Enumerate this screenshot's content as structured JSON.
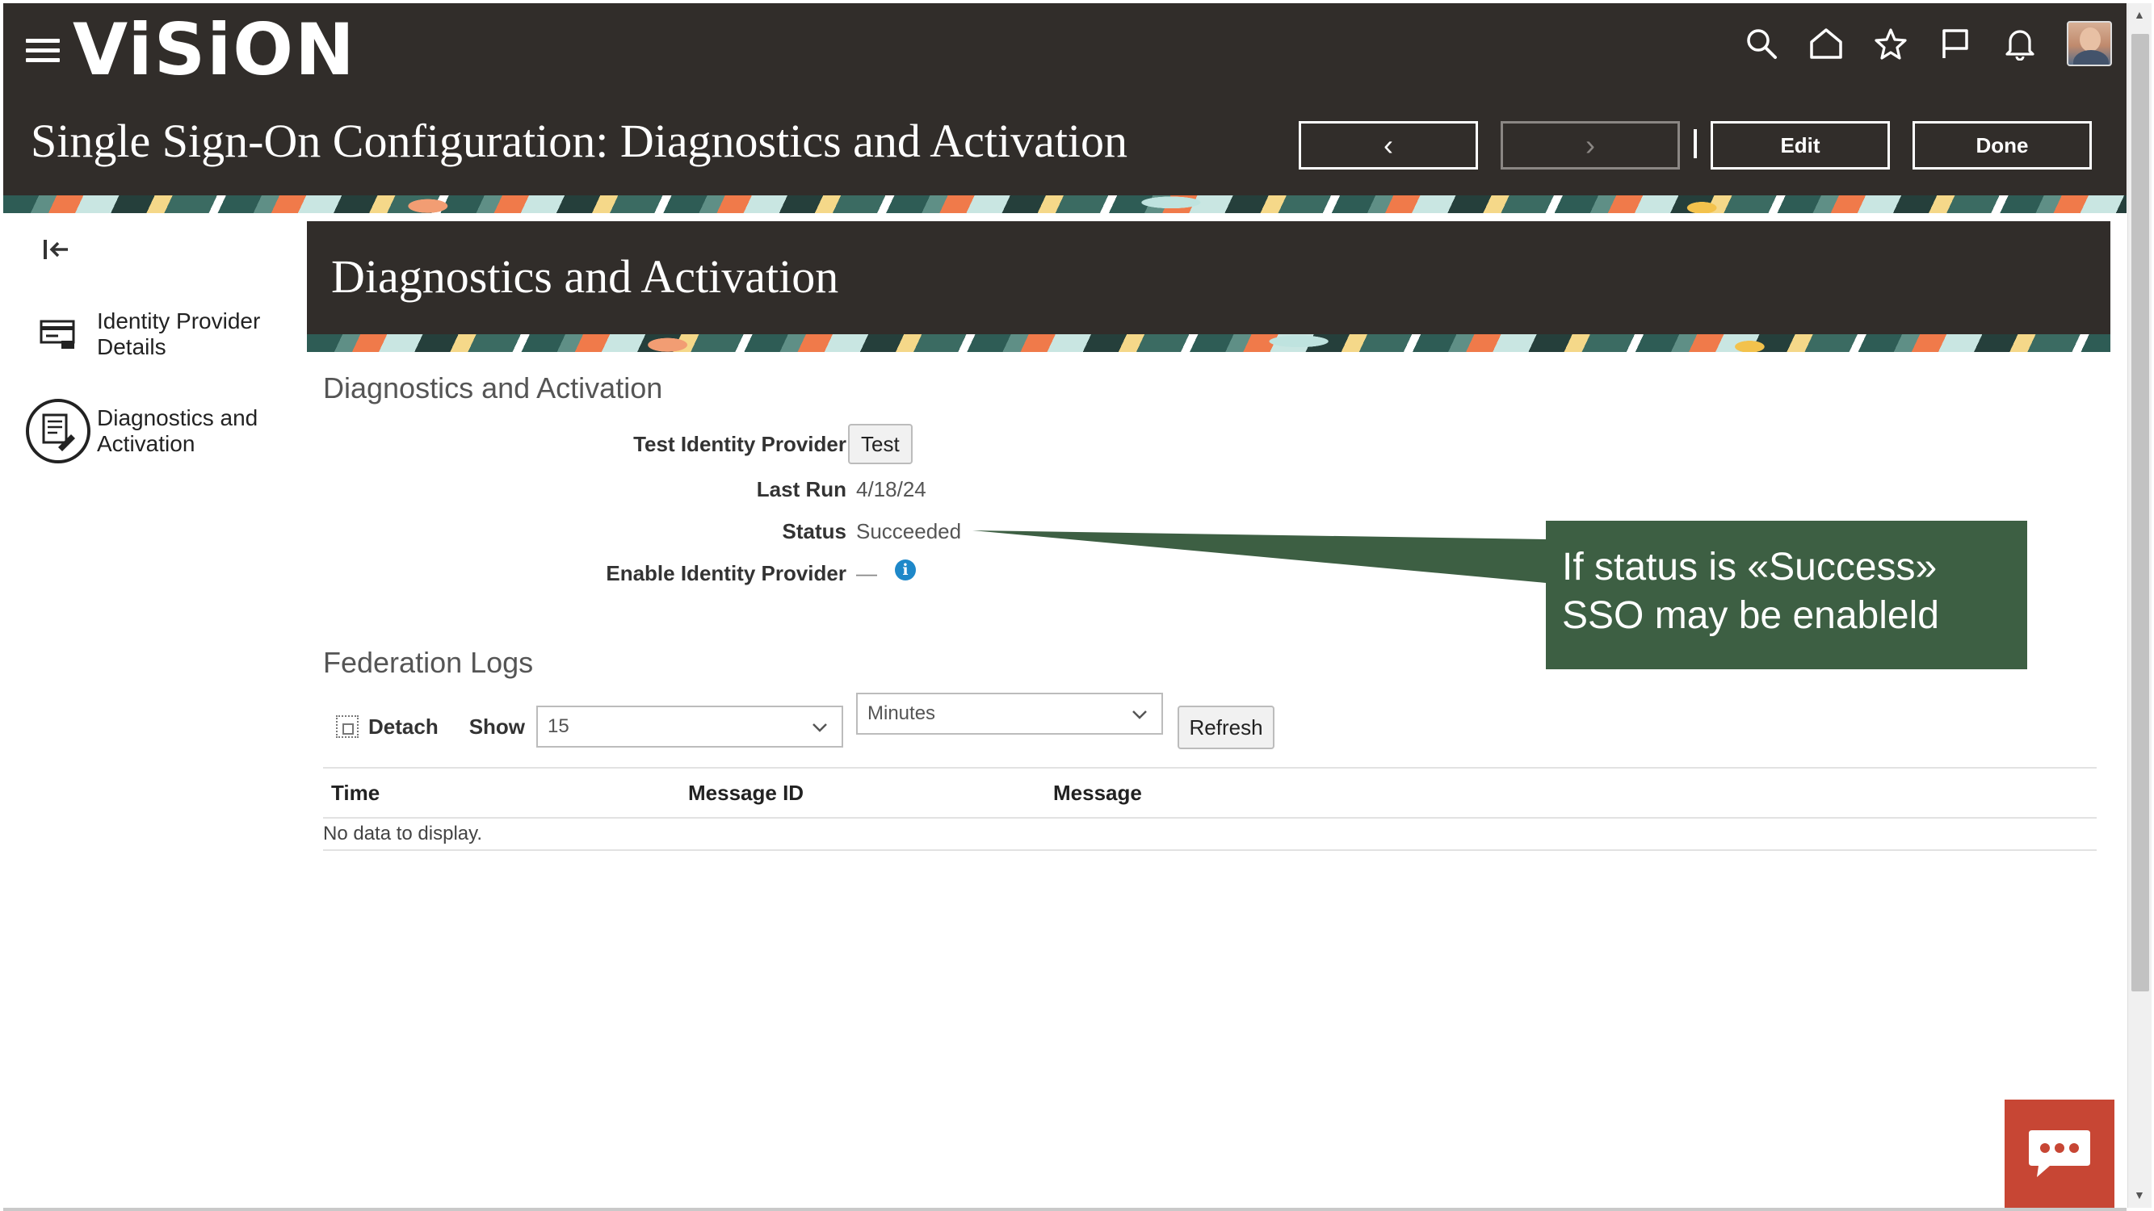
{
  "app": {
    "logo": "ViSiON",
    "page_title": "Single Sign-On Configuration: Diagnostics and Activation",
    "header_icons": [
      "search-icon",
      "home-icon",
      "star-icon",
      "flag-icon",
      "bell-icon"
    ]
  },
  "header_buttons": {
    "back_label": "‹",
    "next_label": "›",
    "separator": "|",
    "edit_label": "Edit",
    "done_label": "Done"
  },
  "sidebar": {
    "items": [
      {
        "label": "Identity Provider Details",
        "icon": "id-card-icon"
      },
      {
        "label": "Diagnostics and Activation",
        "icon": "diagnostics-icon"
      }
    ]
  },
  "banner": {
    "title": "Diagnostics and Activation"
  },
  "diagnostics": {
    "section_title": "Diagnostics and Activation",
    "test_label": "Test Identity Provider",
    "test_button": "Test",
    "last_run_label": "Last Run",
    "last_run_value": "4/18/24",
    "status_label": "Status",
    "status_value": "Succeeded",
    "enable_label": "Enable Identity Provider",
    "enable_value": "—",
    "info_icon_glyph": "i"
  },
  "callout": {
    "line1": "If status is «Success»",
    "line2": "SSO may be enableld",
    "color": "#3d5f43"
  },
  "logs": {
    "section_title": "Federation Logs",
    "detach_label": "Detach",
    "show_label": "Show",
    "show_value": "15",
    "unit_value": "Minutes",
    "refresh_label": "Refresh",
    "columns": [
      "Time",
      "Message ID",
      "Message"
    ],
    "empty_text": "No data to display."
  },
  "colors": {
    "header_bg": "#312d2a",
    "chat_button": "#c74634",
    "info_blue": "#1e88c9"
  }
}
